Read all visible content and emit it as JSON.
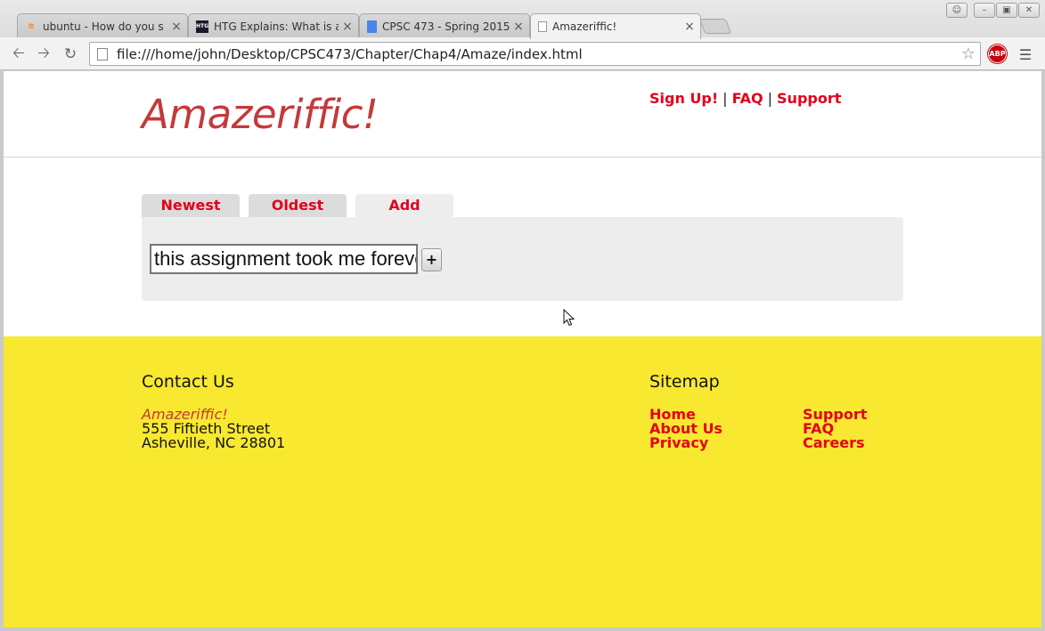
{
  "browser": {
    "tabs": [
      {
        "title": "ubuntu - How do you s",
        "icon": "stackexchange-icon"
      },
      {
        "title": "HTG Explains: What is a",
        "icon": "htg-icon"
      },
      {
        "title": "CPSC 473 - Spring 2015",
        "icon": "google-docs-icon"
      },
      {
        "title": "Amazeriffic!",
        "icon": "page-icon",
        "active": true
      }
    ],
    "url": "file:///home/john/Desktop/CPSC473/Chapter/Chap4/Amaze/index.html",
    "abp_label": "ABP",
    "favicon_htg": "HTG"
  },
  "site": {
    "logo": "Amazeriffic!",
    "nav": [
      {
        "label": "Sign Up!"
      },
      {
        "label": "FAQ"
      },
      {
        "label": "Support"
      }
    ],
    "nav_separator": "|",
    "tabs": [
      {
        "label": "Newest"
      },
      {
        "label": "Oldest"
      },
      {
        "label": "Add",
        "active": true
      }
    ],
    "add_input_value": "this assignment took me forever",
    "add_button_label": "+"
  },
  "footer": {
    "contact": {
      "heading": "Contact Us",
      "name": "Amazeriffic!",
      "street": "555 Fiftieth Street",
      "city": "Asheville, NC 28801"
    },
    "sitemap": {
      "heading": "Sitemap",
      "col1": [
        "Home",
        "About Us",
        "Privacy"
      ],
      "col2": [
        "Support",
        "FAQ",
        "Careers"
      ]
    }
  },
  "colors": {
    "brand_red": "#c4393b",
    "link_red": "#e3001b",
    "footer_yellow": "#f8e830",
    "panel_gray": "#ededed"
  }
}
